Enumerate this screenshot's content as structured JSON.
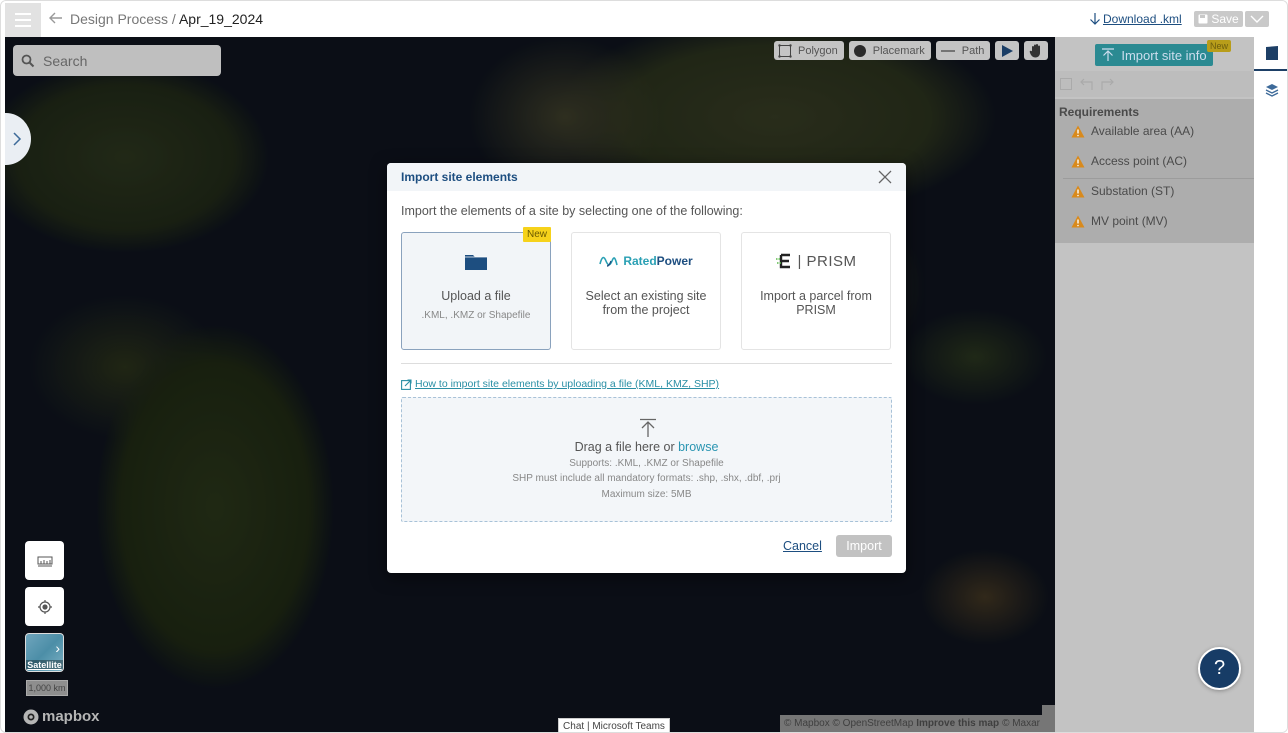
{
  "topbar": {
    "breadcrumb_parent": "Design Process",
    "breadcrumb_separator": " / ",
    "breadcrumb_current": "Apr_19_2024",
    "download_label": "Download .kml",
    "save_label": "Save"
  },
  "map": {
    "search_placeholder": "Search",
    "tools": [
      {
        "label": "Polygon",
        "icon": "polygon-icon"
      },
      {
        "label": "Placemark",
        "icon": "placemark-icon"
      },
      {
        "label": "Path",
        "icon": "path-icon"
      }
    ],
    "satellite_label": "Satellite",
    "scale_label": "1,000 km",
    "logo_text": "mapbox",
    "attribution": {
      "mapbox": "© Mapbox",
      "osm": "© OpenStreetMap",
      "improve": "Improve this map",
      "maxar": "© Maxar"
    },
    "chat_tab": "Chat | Microsoft Teams"
  },
  "right_panel": {
    "import_button": "Import site info",
    "new_badge": "New",
    "requirements_title": "Requirements",
    "requirements": [
      {
        "label": "Available area (AA)",
        "status": "warning"
      },
      {
        "label": "Access point (AC)",
        "status": "warning"
      },
      {
        "label": "Substation (ST)",
        "status": "warning"
      },
      {
        "label": "MV point (MV)",
        "status": "warning"
      }
    ]
  },
  "help_button": "?",
  "modal": {
    "title": "Import site elements",
    "intro": "Import the elements of a site by selecting one of the following:",
    "options": [
      {
        "title": "Upload a file",
        "subtitle": ".KML, .KMZ or Shapefile",
        "badge": "New",
        "selected": true
      },
      {
        "brand_a": "Rated",
        "brand_b": "Power",
        "title": "Select an existing site from the project",
        "selected": false
      },
      {
        "brand": "PRISM",
        "title": "Import a parcel from PRISM",
        "selected": false
      }
    ],
    "help_link": "How to import site elements by uploading a file (KML, KMZ, SHP)",
    "dropzone": {
      "main_text": "Drag a file here or ",
      "browse": "browse",
      "supports": "Supports: .KML, .KMZ or Shapefile",
      "shp_note": "SHP must include all mandatory formats: .shp, .shx, .dbf, .prj",
      "max_size": "Maximum size: 5MB"
    },
    "cancel_label": "Cancel",
    "import_label": "Import"
  },
  "colors": {
    "primary": "#1d4e80",
    "accent": "#2a95b2",
    "badge": "#f6d21b",
    "warning": "#d98a1c"
  }
}
